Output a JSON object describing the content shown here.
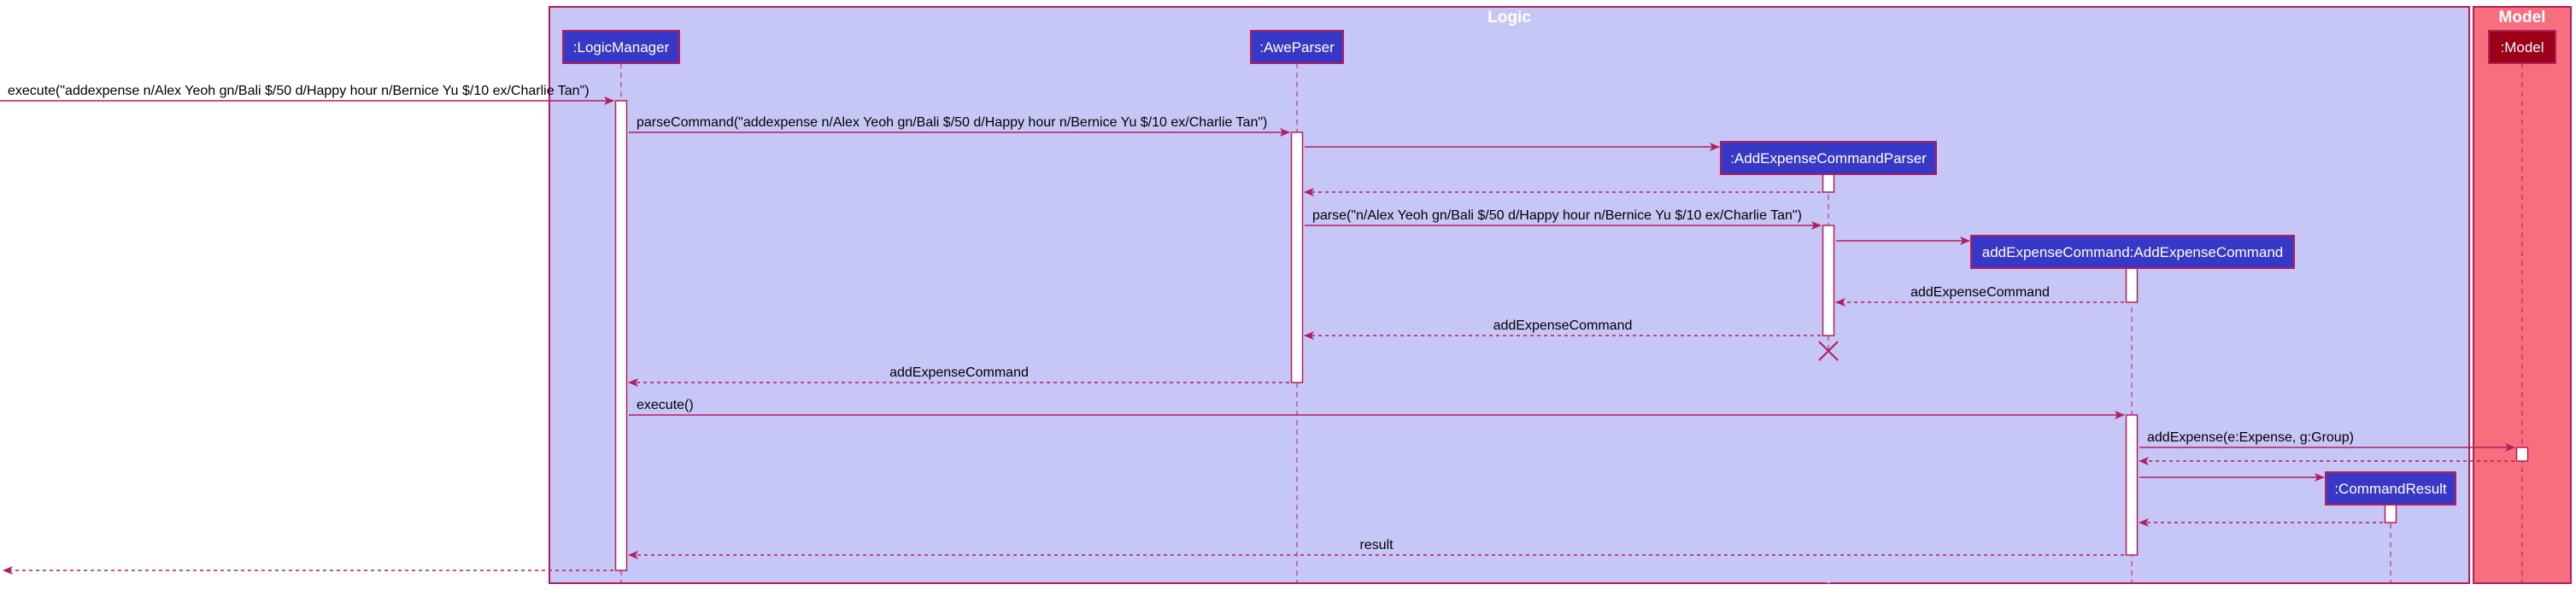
{
  "diagram": {
    "type": "sequence",
    "colors": {
      "logic_fill": "#c6c6f7",
      "logic_border": "#b41e5a",
      "model_fill": "#f76f7e",
      "model_border": "#b41e5a",
      "participant_fill": "#3838c8",
      "model_participant_fill": "#9b0018",
      "arrow": "#b41e5a",
      "activation_fill": "#ffffff"
    },
    "boxes": [
      {
        "id": "logic",
        "title": "Logic"
      },
      {
        "id": "model",
        "title": "Model"
      }
    ],
    "participants": [
      {
        "id": "lm",
        "label": ":LogicManager",
        "box": "logic"
      },
      {
        "id": "ap",
        "label": ":AweParser",
        "box": "logic"
      },
      {
        "id": "aecp",
        "label": ":AddExpenseCommandParser",
        "box": "logic"
      },
      {
        "id": "aec",
        "label": "addExpenseCommand:AddExpenseCommand",
        "box": "logic"
      },
      {
        "id": "cr",
        "label": ":CommandResult",
        "box": "logic"
      },
      {
        "id": "model",
        "label": ":Model",
        "box": "model"
      }
    ],
    "messages": [
      {
        "from": "external",
        "to": "lm",
        "label": "execute(\"addexpense n/Alex Yeoh gn/Bali $/50 d/Happy hour n/Bernice Yu $/10 ex/Charlie Tan\")",
        "kind": "call"
      },
      {
        "from": "lm",
        "to": "ap",
        "label": "parseCommand(\"addexpense n/Alex Yeoh gn/Bali $/50 d/Happy hour n/Bernice Yu $/10 ex/Charlie Tan\")",
        "kind": "call"
      },
      {
        "from": "ap",
        "to": "aecp",
        "label": "",
        "kind": "create"
      },
      {
        "from": "aecp",
        "to": "ap",
        "label": "",
        "kind": "return"
      },
      {
        "from": "ap",
        "to": "aecp",
        "label": "parse(\"n/Alex Yeoh gn/Bali $/50 d/Happy hour n/Bernice Yu $/10 ex/Charlie Tan\")",
        "kind": "call"
      },
      {
        "from": "aecp",
        "to": "aec",
        "label": "",
        "kind": "create"
      },
      {
        "from": "aec",
        "to": "aecp",
        "label": "addExpenseCommand",
        "kind": "return"
      },
      {
        "from": "aecp",
        "to": "ap",
        "label": "addExpenseCommand",
        "kind": "return"
      },
      {
        "from": "ap",
        "to": "lm",
        "label": "addExpenseCommand",
        "kind": "return"
      },
      {
        "from": "lm",
        "to": "aec",
        "label": "execute()",
        "kind": "call"
      },
      {
        "from": "aec",
        "to": "model",
        "label": "addExpense(e:Expense, g:Group)",
        "kind": "call"
      },
      {
        "from": "model",
        "to": "aec",
        "label": "",
        "kind": "return"
      },
      {
        "from": "aec",
        "to": "cr",
        "label": "",
        "kind": "create"
      },
      {
        "from": "cr",
        "to": "aec",
        "label": "",
        "kind": "return"
      },
      {
        "from": "aec",
        "to": "lm",
        "label": "result",
        "kind": "return"
      },
      {
        "from": "lm",
        "to": "external",
        "label": "",
        "kind": "return"
      }
    ],
    "destroyed": [
      "aecp"
    ]
  }
}
